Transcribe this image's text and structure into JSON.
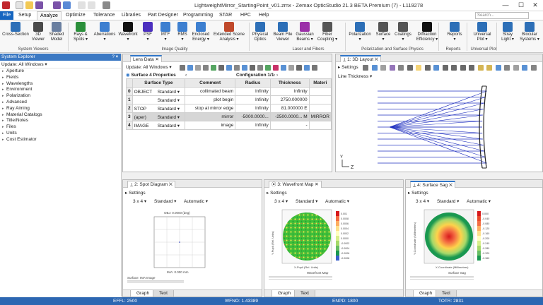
{
  "window": {
    "title": "LightweightMirror_StartingPoint_v01.zmx - Zemax OpticStudio 21.3   BETA   Premium (7) - L119278",
    "minimize": "—",
    "maximize": "☐",
    "close": "✕"
  },
  "menu": {
    "file": "File",
    "items": [
      "Setup",
      "Analyze",
      "Optimize",
      "Tolerance",
      "Libraries",
      "Part Designer",
      "Programming",
      "STAR",
      "HPC",
      "Help"
    ],
    "active": "Analyze",
    "search_placeholder": "Search..."
  },
  "ribbon": {
    "buttons": [
      {
        "label": "Cross-Section",
        "icon": "cross-section-icon"
      },
      {
        "label": "3D\nViewer",
        "icon": "3d-viewer-icon"
      },
      {
        "label": "Shaded\nModel",
        "icon": "shaded-model-icon"
      },
      {
        "label": "Rays &\nSpots ▾",
        "icon": "rays-spots-icon"
      },
      {
        "label": "Aberrations\n▾",
        "icon": "aberrations-icon"
      },
      {
        "label": "Wavefront\n▾",
        "icon": "wavefront-icon"
      },
      {
        "label": "PSF\n▾",
        "icon": "psf-icon"
      },
      {
        "label": "MTF\n▾",
        "icon": "mtf-icon"
      },
      {
        "label": "RMS\n▾",
        "icon": "rms-icon"
      },
      {
        "label": "Enclosed\nEnergy ▾",
        "icon": "enclosed-energy-icon"
      },
      {
        "label": "Extended Scene\nAnalysis ▾",
        "icon": "extended-scene-icon"
      },
      {
        "label": "Physical\nOptics",
        "icon": "physical-optics-icon"
      },
      {
        "label": "Beam File\nViewer",
        "icon": "beam-file-viewer-icon"
      },
      {
        "label": "Gaussian\nBeams ▾",
        "icon": "gaussian-beams-icon"
      },
      {
        "label": "Fiber\nCoupling ▾",
        "icon": "fiber-coupling-icon"
      },
      {
        "label": "Polarization\n▾",
        "icon": "polarization-icon"
      },
      {
        "label": "Surface\n▾",
        "icon": "surface-icon"
      },
      {
        "label": "Coatings\n▾",
        "icon": "coatings-icon"
      },
      {
        "label": "Diffraction\nEfficiency ▾",
        "icon": "diffraction-efficiency-icon"
      },
      {
        "label": "Reports\n▾",
        "icon": "reports-icon"
      },
      {
        "label": "Universal\nPlot ▾",
        "icon": "universal-plot-icon"
      },
      {
        "label": "Stray\nLight ▾",
        "icon": "stray-light-icon"
      },
      {
        "label": "Biocular\nSystems ▾",
        "icon": "biocular-icon"
      }
    ],
    "groups": [
      "System Viewers",
      "Image Quality",
      "Laser and Fibers",
      "Polarization and Surface Physics",
      "Reports",
      "Universal Plot"
    ]
  },
  "system_explorer": {
    "title": "System Explorer",
    "title_icons": "? ▾",
    "update": "Update: All Windows ▾",
    "items": [
      "Aperture",
      "Fields",
      "Wavelengths",
      "Environment",
      "Polarization",
      "Advanced",
      "Ray Aiming",
      "Material Catalogs",
      "Title/Notes",
      "Files",
      "Units",
      "Cost Estimator"
    ]
  },
  "lens_data": {
    "tab": "Lens Data",
    "update": "Update: All Windows ▾",
    "surface_label": "Surface  4 Properties",
    "configuration": "Configuration 1/1",
    "columns": [
      "",
      "Surface Type",
      "Comment",
      "Radius",
      "Thickness",
      "Materi"
    ],
    "rows": [
      {
        "num": "0",
        "name": "OBJECT",
        "type": "Standard ▾",
        "comment": "collimated beam",
        "radius": "Infinity",
        "thickness": "Infinity",
        "material": ""
      },
      {
        "num": "1",
        "name": "",
        "type": "Standard ▾",
        "comment": "plot begin",
        "radius": "Infinity",
        "thickness": "2750.000000",
        "material": ""
      },
      {
        "num": "2",
        "name": "STOP",
        "type": "Standard ▾",
        "comment": "stop at mirror edge",
        "radius": "Infinity",
        "thickness": "81.000000  E",
        "material": ""
      },
      {
        "num": "3",
        "name": "(aper)",
        "type": "Standard ▾",
        "comment": "mirror",
        "radius": "-5000.0000...",
        "thickness": "-2500.0000...  M",
        "material": "MIRROR"
      },
      {
        "num": "4",
        "name": "IMAGE",
        "type": "Standard ▾",
        "comment": "image",
        "radius": "Infinity",
        "thickness": "-",
        "material": ""
      }
    ]
  },
  "layout3d": {
    "tab": "1: 3D Layout",
    "settings": "Settings",
    "line_thickness": "Line Thickness ▾",
    "axis_z": "Z",
    "axis_y": "Y"
  },
  "spot": {
    "tab": "2: Spot Diagram",
    "settings": "Settings",
    "grid": "3 x 4 ▾",
    "mode": "Standard ▾",
    "scale": "Automatic ▾",
    "plot_title": "OBJ: 0.0000 (deg)",
    "plot_sub": "IMA: 0.000 mm",
    "bottom_text": "Surface: IMA Image",
    "tabs": [
      "Graph",
      "Text"
    ]
  },
  "wavefront": {
    "tab": "3: Wavefront Map",
    "settings": "Settings",
    "grid": "3 x 4 ▾",
    "mode": "Standard ▾",
    "scale": "Automatic ▾",
    "xlabel": "X-Pupil (Rel. Units)",
    "ylabel": "Y-Pupil (Rel. Units)",
    "legend": [
      "0.001",
      "0.0008",
      "0.0006",
      "0.0004",
      "0.0002",
      "0.0000",
      "-0.0002",
      "-0.0004",
      "-0.0006",
      "-0.0008"
    ],
    "bottom_text": "Wavefront Map",
    "tabs": [
      "Graph",
      "Text"
    ]
  },
  "sag": {
    "tab": "4: Surface Sag",
    "settings": "Settings",
    "grid": "3 x 4 ▾",
    "mode": "Standard ▾",
    "scale": "Automatic ▾",
    "xlabel": "X-Coordinate (Millimeters)",
    "ylabel": "Y-Coordinate (Millimeters)",
    "legend": [
      "0.000",
      "-0.040",
      "-0.080",
      "-0.120",
      "-0.160",
      "-0.200",
      "-0.240",
      "-0.280",
      "-0.320",
      "-0.360"
    ],
    "bottom_text": "Surface Sag",
    "tabs": [
      "Graph",
      "Text"
    ]
  },
  "status": {
    "effl": "EFFL: 2500",
    "wfno": "WFNO: 1.43389",
    "enpd": "ENPD: 1800",
    "totr": "TOTR: 2831"
  },
  "colors": {
    "accent": "#2c67b2",
    "ray": "#1f2fbf"
  }
}
